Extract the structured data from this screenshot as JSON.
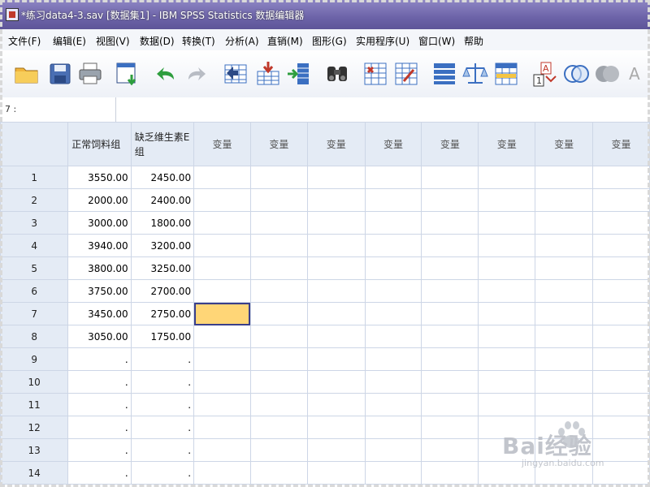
{
  "window": {
    "title": "*练习data4-3.sav [数据集1] - IBM SPSS Statistics 数据编辑器"
  },
  "menu": {
    "items": [
      {
        "label": "文件(F)"
      },
      {
        "label": "编辑(E)"
      },
      {
        "label": "视图(V)"
      },
      {
        "label": "数据(D)"
      },
      {
        "label": "转换(T)"
      },
      {
        "label": "分析(A)"
      },
      {
        "label": "直销(M)"
      },
      {
        "label": "图形(G)"
      },
      {
        "label": "实用程序(U)"
      },
      {
        "label": "窗口(W)"
      },
      {
        "label": "帮助"
      }
    ]
  },
  "toolbar": {
    "icons": [
      "open-folder-icon",
      "save-icon",
      "print-icon",
      "recall-dialog-icon",
      "undo-icon",
      "redo-icon",
      "goto-case-icon",
      "goto-variable-icon",
      "variables-icon",
      "find-icon",
      "insert-cases-icon",
      "insert-variable-icon",
      "split-file-icon",
      "weight-cases-icon",
      "select-cases-icon",
      "value-labels-icon",
      "use-sets-icon",
      "show-all-variables-icon",
      "spell-check-icon"
    ]
  },
  "cell_editor": {
    "reference": "7 :",
    "value": ""
  },
  "grid": {
    "columns": [
      {
        "label": "正常饲料组"
      },
      {
        "label": "缺乏维生素E组"
      },
      {
        "label": "变量"
      },
      {
        "label": "变量"
      },
      {
        "label": "变量"
      },
      {
        "label": "变量"
      },
      {
        "label": "变量"
      },
      {
        "label": "变量"
      },
      {
        "label": "变量"
      },
      {
        "label": "变量"
      }
    ],
    "rows": [
      {
        "num": "1",
        "cells": [
          "3550.00",
          "2450.00"
        ]
      },
      {
        "num": "2",
        "cells": [
          "2000.00",
          "2400.00"
        ]
      },
      {
        "num": "3",
        "cells": [
          "3000.00",
          "1800.00"
        ]
      },
      {
        "num": "4",
        "cells": [
          "3940.00",
          "3200.00"
        ]
      },
      {
        "num": "5",
        "cells": [
          "3800.00",
          "3250.00"
        ]
      },
      {
        "num": "6",
        "cells": [
          "3750.00",
          "2700.00"
        ]
      },
      {
        "num": "7",
        "cells": [
          "3450.00",
          "2750.00"
        ]
      },
      {
        "num": "8",
        "cells": [
          "3050.00",
          "1750.00"
        ]
      },
      {
        "num": "9",
        "cells": [
          ".",
          "."
        ]
      },
      {
        "num": "10",
        "cells": [
          ".",
          "."
        ]
      },
      {
        "num": "11",
        "cells": [
          ".",
          "."
        ]
      },
      {
        "num": "12",
        "cells": [
          ".",
          "."
        ]
      },
      {
        "num": "13",
        "cells": [
          ".",
          "."
        ]
      },
      {
        "num": "14",
        "cells": [
          ".",
          "."
        ]
      }
    ],
    "active_cell": {
      "row": "7",
      "column": "3"
    },
    "colors": {
      "header_bg": "#e4ebf5",
      "active_cell": "#ffd677",
      "title_bar": "#6c63a8"
    }
  },
  "watermark": {
    "logo": "Bai经验",
    "url": "jingyan.baidu.com"
  }
}
